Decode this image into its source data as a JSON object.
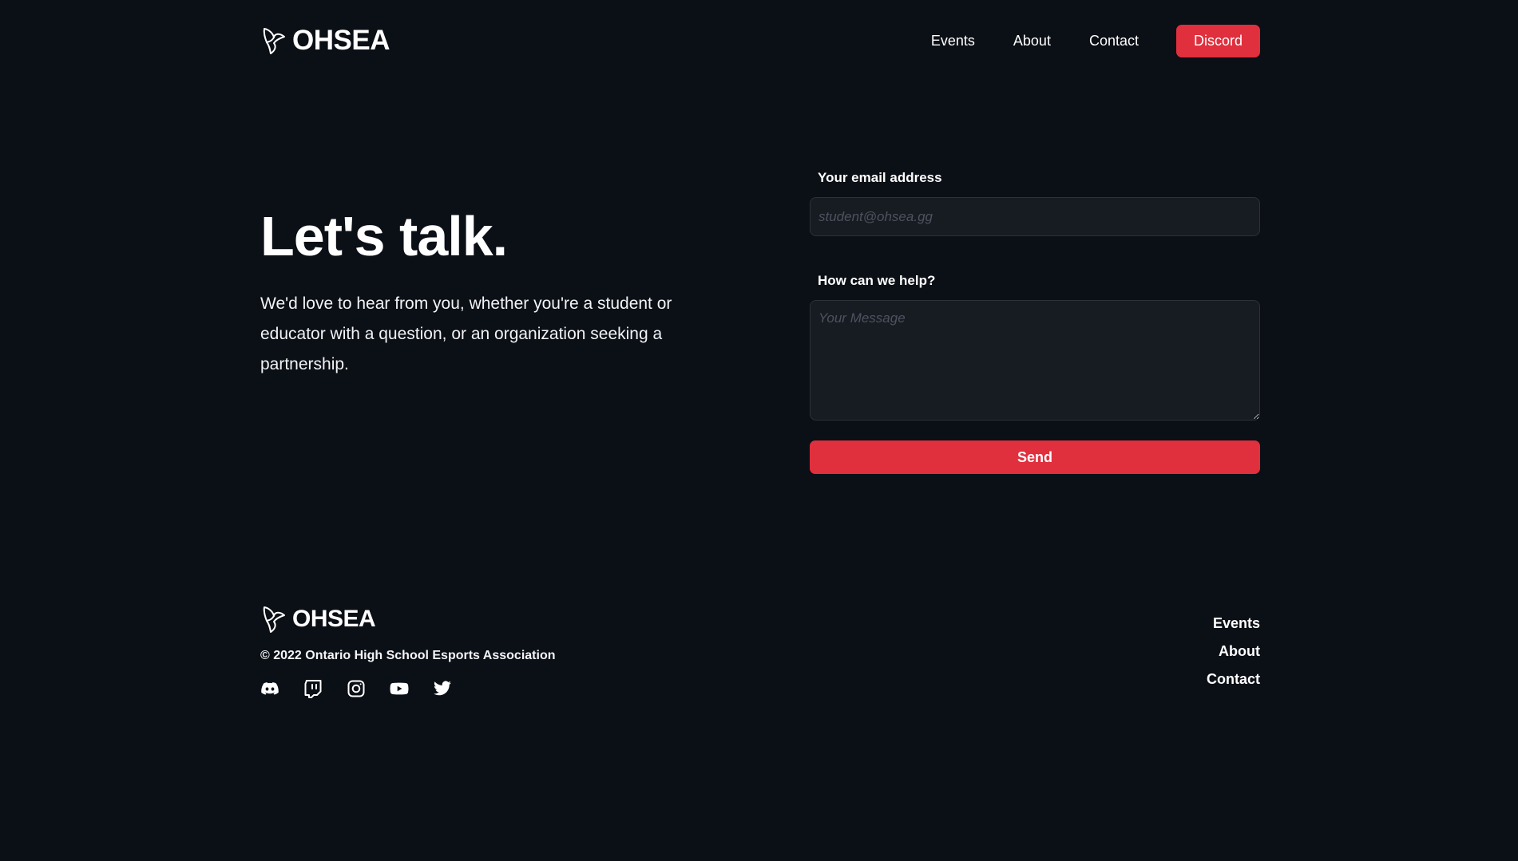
{
  "brand": {
    "name": "OHSEA",
    "logo_icon": "ohsea-logo-icon"
  },
  "nav": {
    "items": [
      {
        "label": "Events"
      },
      {
        "label": "About"
      },
      {
        "label": "Contact"
      }
    ],
    "discord_label": "Discord"
  },
  "hero": {
    "title": "Let's talk.",
    "description": "We'd love to hear from you, whether you're a student or educator with a question, or an organization seeking a partnership."
  },
  "form": {
    "email_label": "Your email address",
    "email_placeholder": "student@ohsea.gg",
    "email_value": "",
    "message_label": "How can we help?",
    "message_placeholder": "Your Message",
    "message_value": "",
    "send_label": "Send"
  },
  "footer": {
    "brand_name": "OHSEA",
    "copyright": "© 2022 Ontario High School Esports Association",
    "socials": [
      "discord-icon",
      "twitch-icon",
      "instagram-icon",
      "youtube-icon",
      "twitter-icon"
    ],
    "links": [
      {
        "label": "Events"
      },
      {
        "label": "About"
      },
      {
        "label": "Contact"
      }
    ]
  },
  "colors": {
    "background": "#0b0f16",
    "accent": "#e02f3d",
    "input_background": "#171b22",
    "input_border": "#2c313a",
    "placeholder": "#4d535e",
    "text": "#ffffff"
  }
}
